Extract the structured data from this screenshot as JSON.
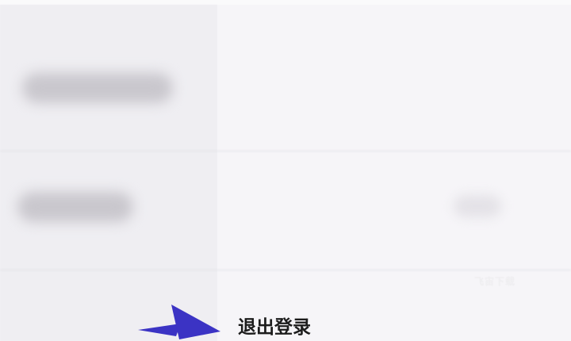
{
  "settings": {
    "blurred_item_1": "",
    "blurred_item_2": "",
    "blurred_value_2": ""
  },
  "logout": {
    "label": "退出登录"
  },
  "watermark": {
    "text": "飞宙下载"
  },
  "annotation": {
    "arrow_color": "#3b33c4",
    "arrow_icon": "arrow-right-annotation"
  },
  "colors": {
    "background": "#f4f3f7",
    "text": "#1c1c1c"
  }
}
